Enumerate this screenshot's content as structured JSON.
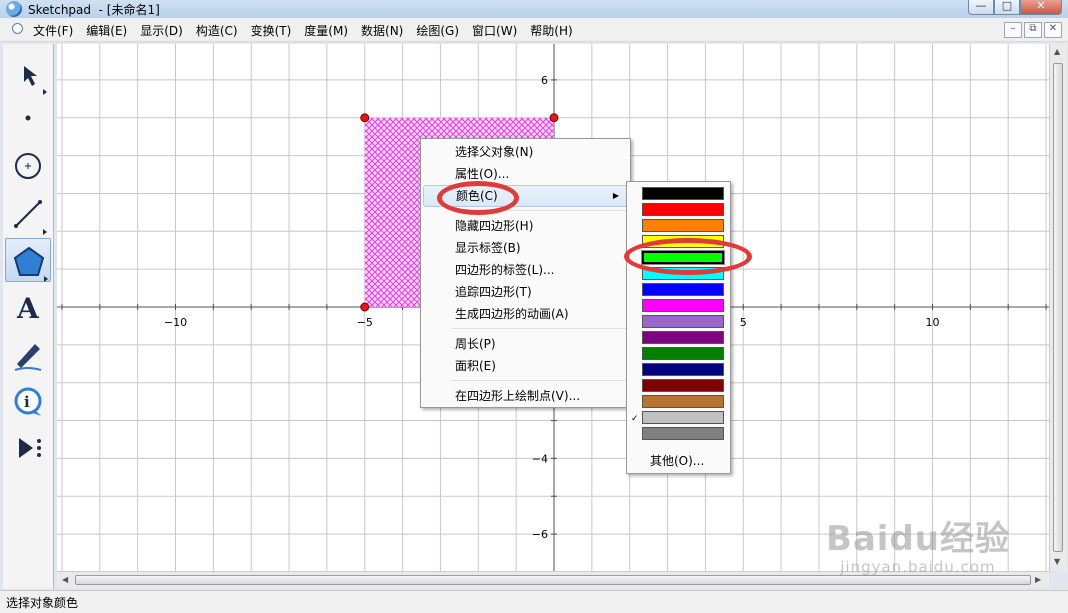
{
  "window": {
    "title": "Sketchpad  - [未命名1]",
    "minimize": "—",
    "maximize": "□",
    "close": "✕"
  },
  "menubar": {
    "items": [
      "文件(F)",
      "编辑(E)",
      "显示(D)",
      "构造(C)",
      "变换(T)",
      "度量(M)",
      "数据(N)",
      "绘图(G)",
      "窗口(W)",
      "帮助(H)"
    ],
    "doc_controls": [
      "–",
      "⧉",
      "✕"
    ]
  },
  "toolbox": {
    "tools": [
      {
        "name": "arrow-tool-icon",
        "active": false
      },
      {
        "name": "point-tool-icon",
        "active": false
      },
      {
        "name": "compass-tool-icon",
        "active": false
      },
      {
        "name": "straightedge-tool-icon",
        "active": false
      },
      {
        "name": "polygon-tool-icon",
        "active": true
      },
      {
        "name": "text-tool-icon",
        "active": false
      },
      {
        "name": "marker-tool-icon",
        "active": false
      },
      {
        "name": "information-tool-icon",
        "active": false
      },
      {
        "name": "custom-tool-icon",
        "active": false
      }
    ],
    "text_tool_glyph": "A"
  },
  "graph": {
    "x_ticks": [
      "−10",
      "−5",
      "5",
      "10"
    ],
    "y_ticks": [
      "6",
      "−4",
      "−6"
    ],
    "quadrilateral": {
      "corners": [
        [
          -5,
          5
        ],
        [
          0,
          5
        ],
        [
          0,
          0
        ],
        [
          -5,
          0
        ]
      ],
      "fill": "#e040e0",
      "pattern": "crosshatch"
    }
  },
  "context_menu": {
    "groups": [
      [
        "选择父对象(N)",
        "属性(O)...",
        "颜色(C)"
      ],
      [
        "隐藏四边形(H)",
        "显示标签(B)",
        "四边形的标签(L)...",
        "追踪四边形(T)",
        "生成四边形的动画(A)"
      ],
      [
        "周长(P)",
        "面积(E)"
      ],
      [
        "在四边形上绘制点(V)..."
      ]
    ],
    "highlighted": "颜色(C)",
    "submenu_arrow": "▶"
  },
  "color_submenu": {
    "swatches": [
      "#000000",
      "#ff0000",
      "#ff8000",
      "#ffff00",
      "#00ff00",
      "#00ffff",
      "#0000ff",
      "#ff00ff",
      "#9966cc",
      "#800080",
      "#008000",
      "#000080",
      "#800000",
      "#b87333",
      "#c0c0c0",
      "#808080"
    ],
    "selected_index": 4,
    "checkmark": "✓",
    "other": "其他(O)..."
  },
  "statusbar": {
    "text": "选择对象颜色"
  },
  "watermark": {
    "logo": "Baidu经验",
    "url": "jingyan.baidu.com"
  }
}
